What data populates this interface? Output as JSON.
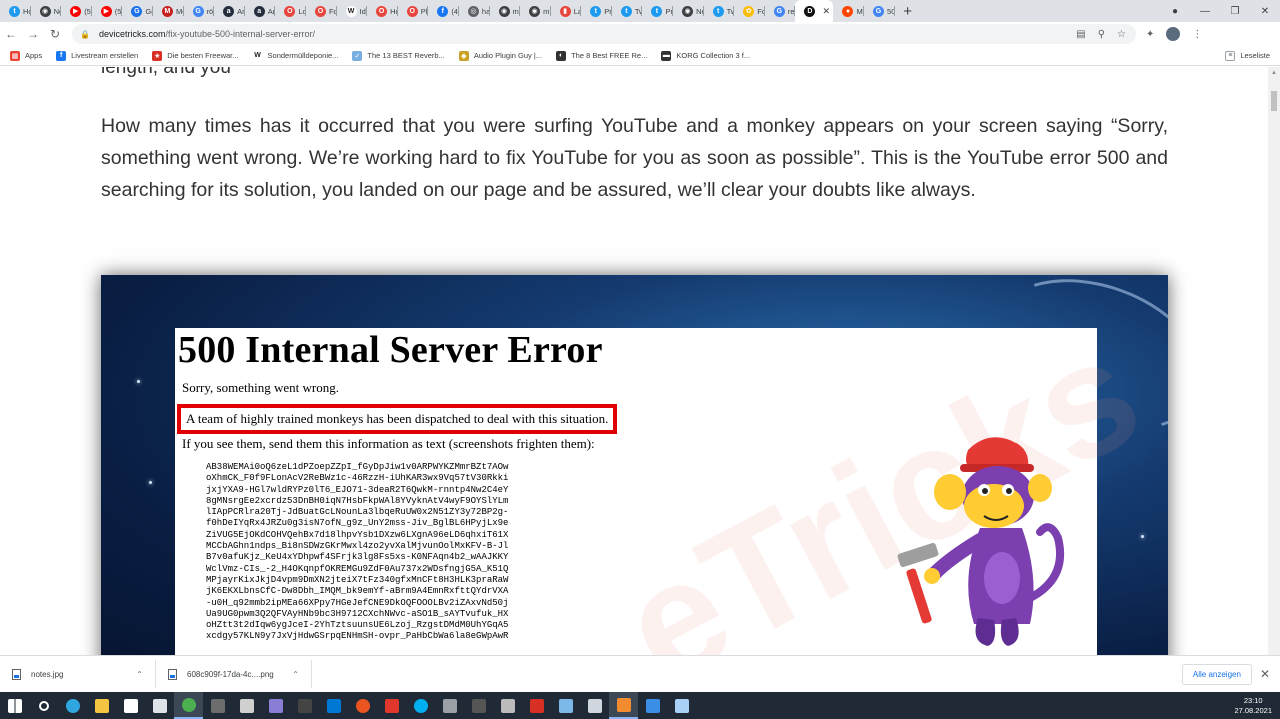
{
  "browser": {
    "tabs": [
      {
        "label": "Ho",
        "color": "#1d9bf0",
        "glyph": "t"
      },
      {
        "label": "Ne",
        "color": "#3c4043",
        "glyph": "◉"
      },
      {
        "label": "(58",
        "color": "#ff0000",
        "glyph": "▶"
      },
      {
        "label": "(58",
        "color": "#ff0000",
        "glyph": "▶"
      },
      {
        "label": "Go",
        "color": "#1a73e8",
        "glyph": "G"
      },
      {
        "label": "Me",
        "color": "#c5221f",
        "glyph": "M"
      },
      {
        "label": "röy",
        "color": "#4285f4",
        "glyph": "G"
      },
      {
        "label": "An",
        "color": "#232f3e",
        "glyph": "a"
      },
      {
        "label": "An",
        "color": "#232f3e",
        "glyph": "a"
      },
      {
        "label": "Lo",
        "color": "#e8453c",
        "glyph": "O"
      },
      {
        "label": "For",
        "color": "#e8453c",
        "glyph": "O"
      },
      {
        "label": "Ide",
        "color": "#ffffff",
        "glyph": "W"
      },
      {
        "label": "Ho",
        "color": "#e8453c",
        "glyph": "O"
      },
      {
        "label": "Ple",
        "color": "#e8453c",
        "glyph": "O"
      },
      {
        "label": "(4)",
        "color": "#1877f2",
        "glyph": "f"
      },
      {
        "label": "ha",
        "color": "#5f6368",
        "glyph": "◎"
      },
      {
        "label": "m1",
        "color": "#3c4043",
        "glyph": "◉"
      },
      {
        "label": "m1",
        "color": "#3c4043",
        "glyph": "◉"
      },
      {
        "label": "La",
        "color": "#e8453c",
        "glyph": "▮"
      },
      {
        "label": "Pro",
        "color": "#1d9bf0",
        "glyph": "t"
      },
      {
        "label": "Tw",
        "color": "#1d9bf0",
        "glyph": "t"
      },
      {
        "label": "Pro",
        "color": "#1d9bf0",
        "glyph": "t"
      },
      {
        "label": "Ne",
        "color": "#3c4043",
        "glyph": "◉"
      },
      {
        "label": "Tw",
        "color": "#1d9bf0",
        "glyph": "t"
      },
      {
        "label": "Fot",
        "color": "#fbbc04",
        "glyph": "✿"
      },
      {
        "label": "rep",
        "color": "#4285f4",
        "glyph": "G"
      }
    ],
    "active_tab": {
      "label": "",
      "color": "#111111",
      "glyph": "D"
    },
    "trailing_tabs": [
      {
        "label": "Mc",
        "color": "#ff4500",
        "glyph": "●"
      },
      {
        "label": "50",
        "color": "#4285f4",
        "glyph": "G"
      }
    ],
    "new_tab_label": "+",
    "url_host": "devicetricks.com",
    "url_path": "/fix-youtube-500-internal-server-error/",
    "bookmarks": [
      {
        "label": "Apps",
        "color": "#ea4335",
        "glyph": "▦"
      },
      {
        "label": "Livestream erstellen",
        "color": "#1877f2",
        "glyph": "f"
      },
      {
        "label": "Die besten Freewar...",
        "color": "#d93025",
        "glyph": "★"
      },
      {
        "label": "Sondermülldeponie...",
        "color": "#ffffff",
        "glyph": "W"
      },
      {
        "label": "The 13 BEST Reverb...",
        "color": "#7baee0",
        "glyph": "✓"
      },
      {
        "label": "Audio Plugin Guy |...",
        "color": "#c9a227",
        "glyph": "◆"
      },
      {
        "label": "The 8 Best FREE Re...",
        "color": "#333333",
        "glyph": "◐"
      },
      {
        "label": "KORG Collection 3 f...",
        "color": "#333333",
        "glyph": "▬"
      }
    ],
    "reading_list": "Leseliste"
  },
  "article": {
    "cut_line": "length, and you",
    "intro": "How many times has it occurred that you were surfing YouTube and a monkey appears on your screen saying “Sorry, something went wrong. We’re working hard to fix YouTube for you as soon as possible”. This is the YouTube error 500 and searching for its solution, you landed on our page and be assured, we’ll clear your doubts like always."
  },
  "error_image": {
    "title": "500 Internal Server Error",
    "sorry": "Sorry, something went wrong.",
    "monkeys": "A team of highly trained monkeys has been dispatched to deal with this situation.",
    "send_info": "If you see them, send them this information as text (screenshots frighten them):",
    "code": "AB38WEMAi0oQ6zeL1dPZoepZZpI_fGyDpJiw1v0ARPWYKZMmrBZt7AOw\noXhmCK_F0f9FLonAcV2ReBWz1c-46RzzH-iUhKAR3wx9Vq57tV30Rkki\njxjYXA9-HGl7wldRYPz0lT6_EJO71-3deaR2T6QwkM-rnntp4Nw2C4eY\n8gMNsrgEe2xcrdz53DnBH0iqN7HsbFkpWAl8YVyknAtV4wyF9OYSlYLm\nlIApPCRlra20Tj-JdBuatGcLNounLa3lbqeRuUW0x2N51ZY3y72BP2g-\nf0hDeIYqRx4JRZu0g3isN7ofN_g9z_UnY2mss-Jiv_BglBL6HPyjLx9e\nZiVUG5EjOKdCOHVQehBx7d18lhpvYsb1DXzw6LXgnA96eLD6qhxiT61X\nMCCbAGhn1ndps_Bi8nSDWzGKrMwxl4zo2yvXalMjvunOolMxKFV-B-Jl\nB7v0afuKjz_KeU4xYDhpwf4SFrjk3lg8Fs5xs-K0NFAqn4b2_wAAJKKY\nWclVmz-CIs_-2_H4OKqnpfOKREMGu9ZdF0Au737x2WDsfngjG5A_K51Q\nMPjayrKixJkjD4vpm9DmXN2jteiX7tFz340gfxMnCFt8H3HLK3praRaW\njK6EKXLbnsCfC-Dw8Dbh_IMQM_bk9emYf-aBrm9A4EmnRxfttQYdrVXA\n-u0H_q92mmb2ipMEa66XPpy7HGeJefCNE9DkOQFOOOLBv2iZAxvNd50j\nUa9UG0pwm3Q2QFVAyHNb9bc3H9712CXchNWvc-aSO1B_sAYTvufuk_HX\noHZtt3t2dIqw6ygJceI-2YhTztsuunsUE6Lzoj_RzgstDMdM0UhYGqA5\nxcdgy57KLN9y7JxVjHdwGSrpqENHmSH-ovpr_PaHbCbWa6la8eGWpAwR"
  },
  "downloads": [
    {
      "name": "notes.jpg"
    },
    {
      "name": "608c909f-17da-4c....png"
    }
  ],
  "show_all": "Alle anzeigen",
  "taskbar": {
    "icons": [
      {
        "name": "windows",
        "color": "#ffffff"
      },
      {
        "name": "search",
        "color": "#ffffff"
      },
      {
        "name": "edge",
        "color": "#2fa6e0"
      },
      {
        "name": "explorer",
        "color": "#f4c542"
      },
      {
        "name": "store",
        "color": "#ffffff"
      },
      {
        "name": "mail",
        "color": "#dfe3e8"
      },
      {
        "name": "chrome",
        "color": "#4caf50"
      },
      {
        "name": "tool-a",
        "color": "#6d6d6d"
      },
      {
        "name": "tool-b",
        "color": "#d0d0d0"
      },
      {
        "name": "tool-c",
        "color": "#8a7dd6"
      },
      {
        "name": "live",
        "color": "#444444"
      },
      {
        "name": "skype-a",
        "color": "#0078d4"
      },
      {
        "name": "ubuntu",
        "color": "#e95420"
      },
      {
        "name": "app-red",
        "color": "#e0362c"
      },
      {
        "name": "skype-b",
        "color": "#00aff0"
      },
      {
        "name": "app-grey",
        "color": "#9aa0a6"
      },
      {
        "name": "vst",
        "color": "#555555"
      },
      {
        "name": "app-x",
        "color": "#bbbbbb"
      },
      {
        "name": "app-rec",
        "color": "#d93025"
      },
      {
        "name": "app-blue",
        "color": "#7cb8e8"
      },
      {
        "name": "app-box",
        "color": "#cfd6de"
      },
      {
        "name": "app-orange",
        "color": "#f28b30"
      },
      {
        "name": "app-photo",
        "color": "#3a8ee6"
      },
      {
        "name": "app-pencil",
        "color": "#a9d0f5"
      }
    ],
    "time": "23:10",
    "date": "27.08.2021"
  }
}
